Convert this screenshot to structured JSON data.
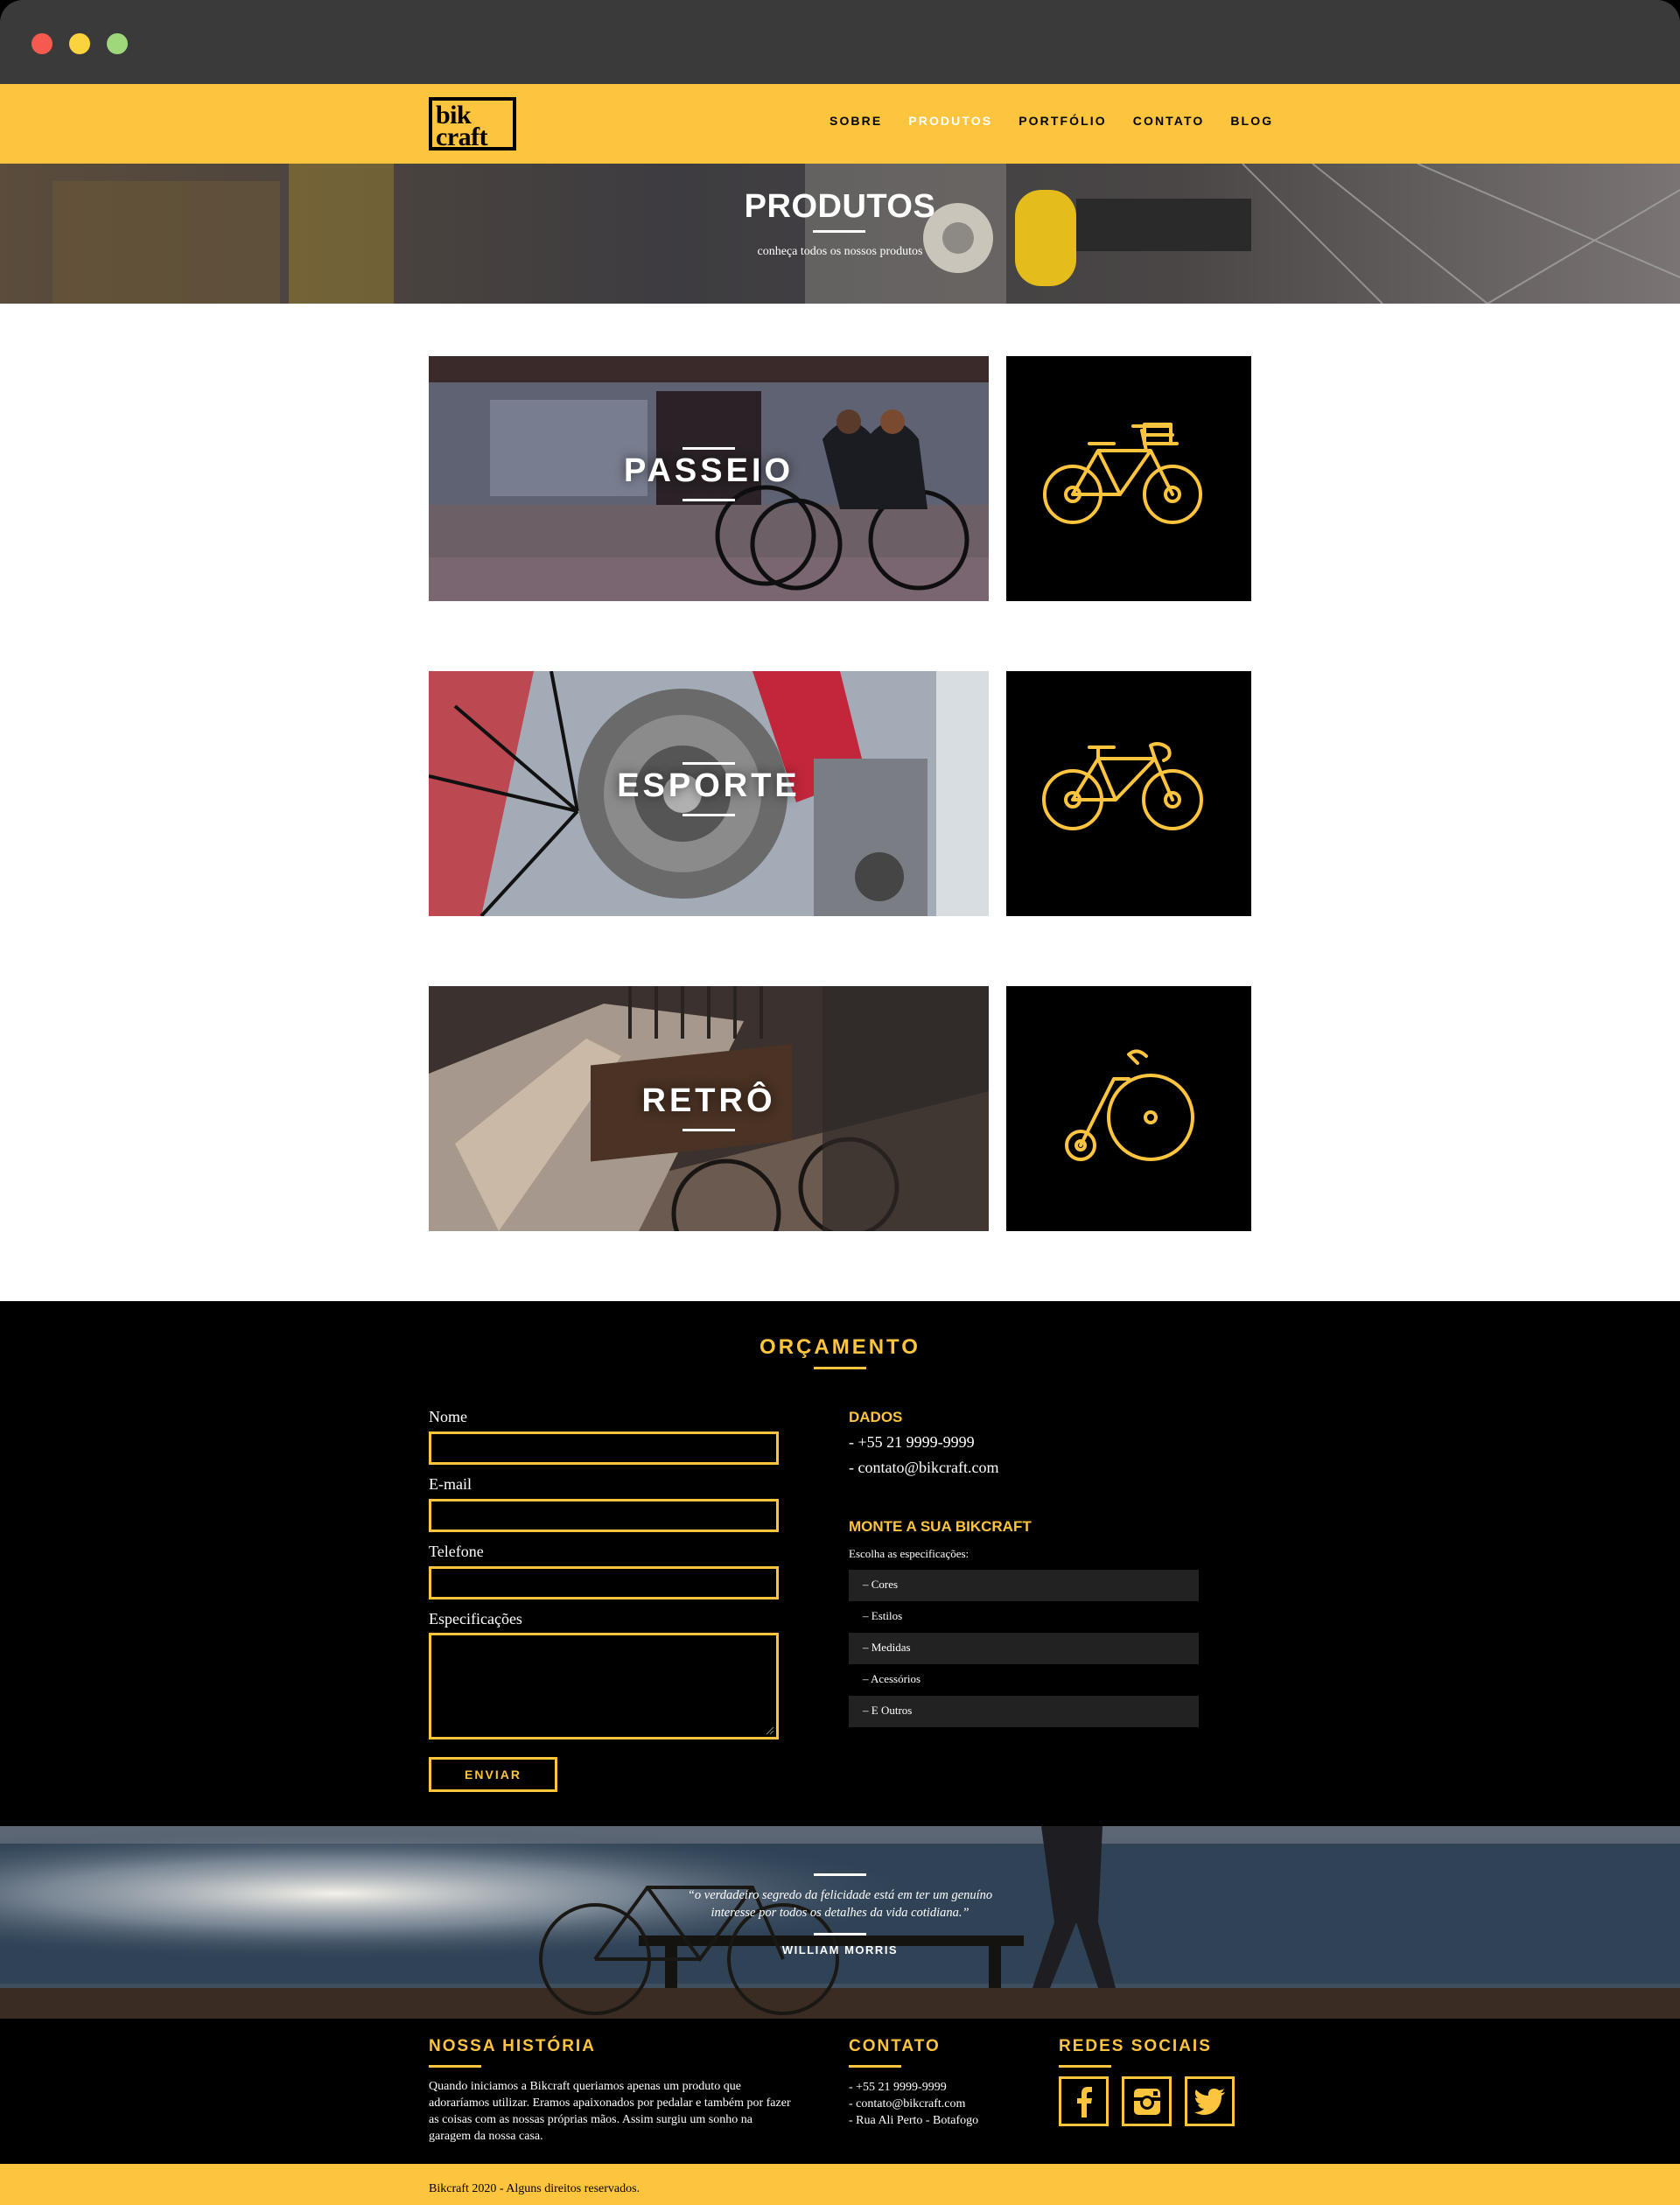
{
  "brand": {
    "logo_line1": "bik",
    "logo_line2": "craft",
    "accent": "#fdc43e"
  },
  "nav": {
    "items": [
      "SOBRE",
      "PRODUTOS",
      "PORTFÓLIO",
      "CONTATO",
      "BLOG"
    ],
    "active": "PRODUTOS"
  },
  "hero": {
    "title": "PRODUTOS",
    "subtitle": "conheça todos os nossos produtos"
  },
  "products": [
    {
      "label": "PASSEIO",
      "icon": "city-bike-icon"
    },
    {
      "label": "ESPORTE",
      "icon": "road-bike-icon"
    },
    {
      "label": "RETRÔ",
      "icon": "penny-farthing-icon"
    }
  ],
  "budget": {
    "title": "ORÇAMENTO",
    "fields": {
      "name": "Nome",
      "email": "E-mail",
      "phone": "Telefone",
      "specs": "Especificações"
    },
    "submit": "ENVIAR",
    "dados_title": "DADOS",
    "dados": [
      "- +55 21 9999-9999",
      "- contato@bikcraft.com"
    ],
    "monte_title": "MONTE A SUA BIKCRAFT",
    "monte_sub": "Escolha as especificações:",
    "specs": [
      "– Cores",
      "– Estilos",
      "– Medidas",
      "– Acessórios",
      "– E Outros"
    ]
  },
  "quote": {
    "text": "“o verdadeiro segredo da felicidade está em ter um genuíno interesse por todos os detalhes da vida cotidiana.”",
    "author": "WILLIAM MORRIS"
  },
  "footer": {
    "historia_title": "NOSSA HISTÓRIA",
    "historia_text": "Quando iniciamos a Bikcraft queriamos apenas um produto que adoraríamos utilizar. Eramos apaixonados por pedalar e também por fazer as coisas com as nossas próprias mãos. Assim surgiu um sonho na garagem da nossa casa.",
    "contato_title": "CONTATO",
    "contato": [
      "- +55 21 9999-9999",
      "- contato@bikcraft.com",
      "- Rua Ali Perto - Botafogo"
    ],
    "redes_title": "REDES SOCIAIS",
    "redes": [
      "facebook-icon",
      "instagram-icon",
      "twitter-icon"
    ],
    "copyright": "Bikcraft 2020 - Alguns direitos reservados."
  }
}
